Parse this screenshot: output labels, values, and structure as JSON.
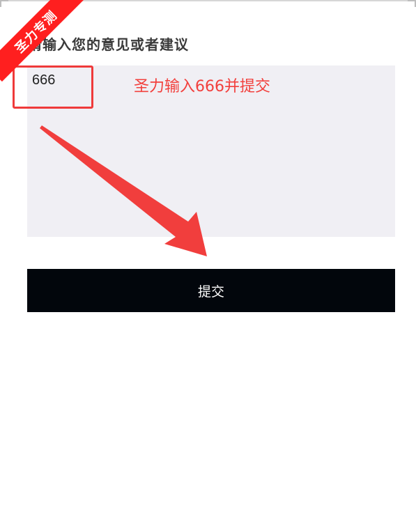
{
  "form": {
    "prompt_label": "请输入您的意见或者建议",
    "feedback_value": "666",
    "submit_label": "提交"
  },
  "annotation": {
    "instruction": "圣力输入666并提交",
    "ribbon": "圣力专测",
    "accent_color": "#f2403d"
  }
}
